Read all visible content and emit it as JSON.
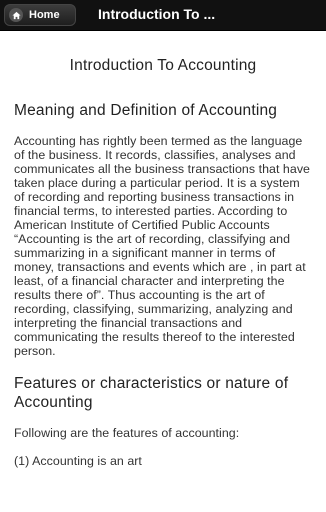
{
  "header": {
    "home_label": "Home",
    "title": "Introduction To ..."
  },
  "content": {
    "page_title": "Introduction To Accounting",
    "sections": [
      {
        "heading": "Meaning and Definition of Accounting",
        "body": "Accounting has rightly been termed as the language of the business. It records, classifies, analyses and communicates all the business transactions that have taken place during a particular period. It is a system of recording and reporting business transactions in financial terms, to interested parties. According to American Institute of Certified Public Accounts “Accounting is the art of recording, classifying and summarizing in a significant manner in terms of money, transactions and events which are , in part at least, of a financial character and interpreting the results there of”. Thus accounting is the art of recording, classifying, summarizing, analyzing and interpreting the financial transactions and communicating the results thereof to the interested person."
      },
      {
        "heading": "Features or characteristics or nature of Accounting",
        "body": "Following are the features of accounting:",
        "list_first": "(1) Accounting is an art"
      }
    ]
  }
}
